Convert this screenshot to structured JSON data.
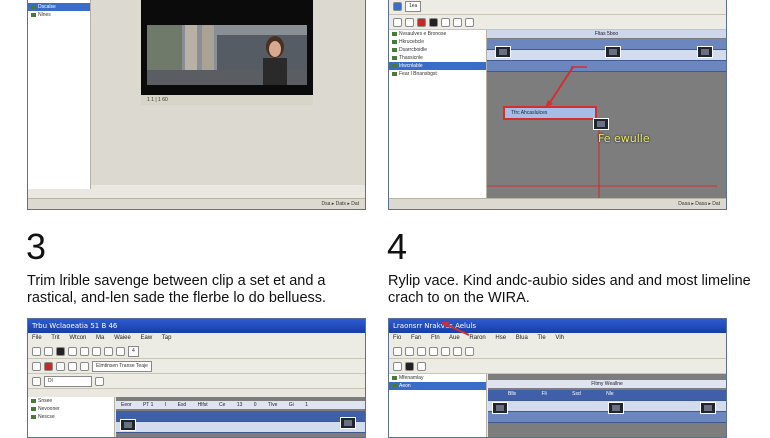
{
  "steps": [
    {
      "number": "3",
      "text_line1": "Trim lrible savenge between clip a set et and a",
      "text_line2": "rastical, and-len sade the flerbe lo do belluess."
    },
    {
      "number": "4",
      "text_line1": "Rylip vace. Kind andc-aubio sides and and most limeline",
      "text_line2": "crach to on the WIRA."
    }
  ],
  "panel1": {
    "tree_items": [
      "Dscalse",
      "Nlnes"
    ],
    "preview_label": "1 1 | 1 60",
    "status": "Dsa ▸ Dats ▸ Dat"
  },
  "panel2": {
    "toolbar_field": "1ea",
    "tree_items": [
      "Nvsaulves e Bronose",
      "Hkrucebcle",
      "Dsarrcboidle",
      "Thassicnle",
      "Irlwcnlable",
      "Fear l Bnansbgst"
    ],
    "ruler_label": "Fltas 5boo",
    "track_label": "Tfrc Ahcaslulces",
    "callout": "Fe ewulle",
    "status": "Dasa ▸ Dasa ▸ Dat"
  },
  "panel3": {
    "title": "Trbu Wclaoeatia 51 B 46",
    "menu": [
      "File",
      "Trit",
      "Wtcon",
      "Ma",
      "Waiee",
      "Eaw",
      "Tap"
    ],
    "field_value": "4",
    "dropdown": "Dl",
    "label_row": "Elmtinsen Transe Teaje",
    "tree_items": [
      "Snsee",
      "Nevooner",
      "Nescse"
    ],
    "ruler_cols": [
      "Eeor",
      "PT 1",
      "I",
      "Esd",
      "Hlfst",
      "Ce",
      "13",
      "0",
      "Tlve",
      "Gi",
      "1"
    ]
  },
  "panel4": {
    "title": "Lraonsrr Nrakves Aeluls",
    "menu": [
      "Fio",
      "Fan",
      "Ftn",
      "Aue",
      "Raron",
      "Hse",
      "Blua",
      "Tle",
      "Vlh"
    ],
    "tree_items": [
      "Mfenamlay",
      "Aeon"
    ],
    "timeline_title": "Fltmy Weallne",
    "track_labels": [
      "Blls",
      "Fli",
      "Ssd",
      "Nle"
    ]
  },
  "colors": {
    "accent_red": "#d32f2f",
    "title_blue": "#173ea6",
    "callout_yellow": "#e8e86a"
  }
}
